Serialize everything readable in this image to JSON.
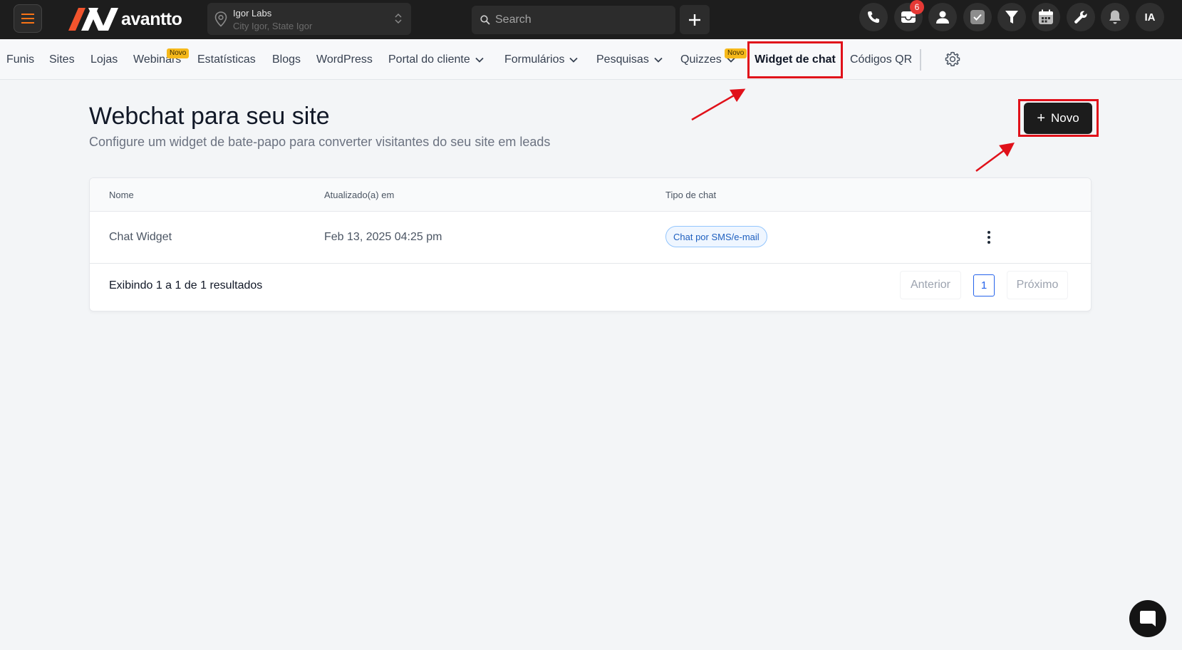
{
  "header": {
    "brand": "avantto",
    "location": {
      "name": "Igor Labs",
      "subtitle": "City Igor, State Igor"
    },
    "search_placeholder": "Search",
    "notification_count": "6",
    "user_initials": "IA",
    "icons": [
      "menu-icon",
      "location-pin-icon",
      "updown-icon",
      "search-icon",
      "plus-icon",
      "phone-icon",
      "inbox-icon",
      "user-icon",
      "task-check-icon",
      "funnel-icon",
      "calendar-icon",
      "wrench-icon",
      "bell-icon"
    ]
  },
  "nav": {
    "items": [
      {
        "label": "Funis"
      },
      {
        "label": "Sites"
      },
      {
        "label": "Lojas"
      },
      {
        "label": "Webinars",
        "badge": "Novo"
      },
      {
        "label": "Estatísticas"
      },
      {
        "label": "Blogs"
      },
      {
        "label": "WordPress"
      },
      {
        "label": "Portal do cliente"
      },
      {
        "label": "Formulários"
      },
      {
        "label": "Pesquisas"
      },
      {
        "label": "Quizzes",
        "badge": "Novo"
      },
      {
        "label": "Widget de chat",
        "active": true
      },
      {
        "label": "Códigos QR"
      }
    ]
  },
  "page": {
    "title": "Webchat para seu site",
    "subtitle": "Configure um widget de bate-papo para converter visitantes do seu site em leads",
    "new_button": "Novo"
  },
  "table": {
    "columns": [
      "Nome",
      "Atualizado(a) em",
      "Tipo de chat"
    ],
    "rows": [
      {
        "name": "Chat Widget",
        "updated": "Feb 13, 2025 04:25 pm",
        "type": "Chat por SMS/e-mail"
      }
    ],
    "footer": "Exibindo 1 a 1 de 1 resultados",
    "pagination": {
      "prev": "Anterior",
      "page": "1",
      "next": "Próximo"
    }
  },
  "colors": {
    "topbar": "#1d1d1d",
    "highlight": "#e0111a",
    "accent": "#f97316",
    "link_blue": "#2563eb",
    "badge_yellow": "#f6b91b"
  }
}
